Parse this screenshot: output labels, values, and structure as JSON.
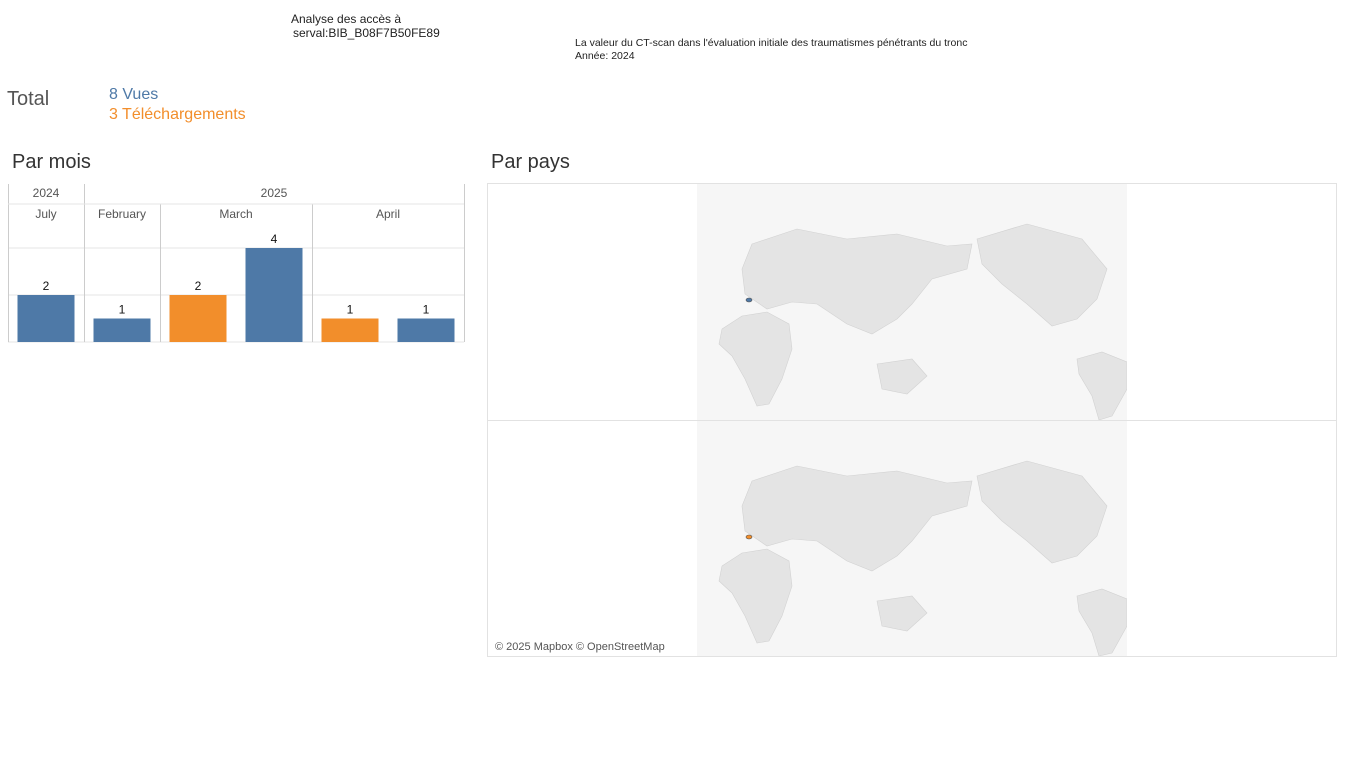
{
  "header": {
    "title_line1": "Analyse des accès à",
    "title_line2": "serval:BIB_B08F7B50FE89",
    "doc_title": "La valeur du CT-scan dans l'évaluation initiale des traumatismes pénétrants du tronc",
    "doc_year": "Année: 2024"
  },
  "totals": {
    "label": "Total",
    "vues": "8 Vues",
    "telechargements": "3 Téléchargements"
  },
  "colors": {
    "vues": "#4e79a7",
    "telechargements": "#f28e2b",
    "grid": "#e6e6e6",
    "divider": "#cccccc"
  },
  "sections": {
    "par_mois": "Par mois",
    "par_pays": "Par pays"
  },
  "chart_data": {
    "type": "bar",
    "years": [
      {
        "label": "2024",
        "months": 1
      },
      {
        "label": "2025",
        "months": 3
      }
    ],
    "months": [
      "July",
      "February",
      "March",
      "April"
    ],
    "series": [
      {
        "name": "Vues",
        "color": "#4e79a7",
        "values": [
          2,
          1,
          4,
          1
        ]
      },
      {
        "name": "Téléchargements",
        "color": "#f28e2b",
        "values": [
          null,
          null,
          2,
          1
        ]
      }
    ],
    "ylim": [
      0,
      4
    ],
    "grid": true
  },
  "map": {
    "credit": "© 2025 Mapbox © OpenStreetMap",
    "panels": [
      {
        "series": "Vues",
        "marker_color": "#4e79a7"
      },
      {
        "series": "Téléchargements",
        "marker_color": "#f28e2b"
      }
    ]
  }
}
